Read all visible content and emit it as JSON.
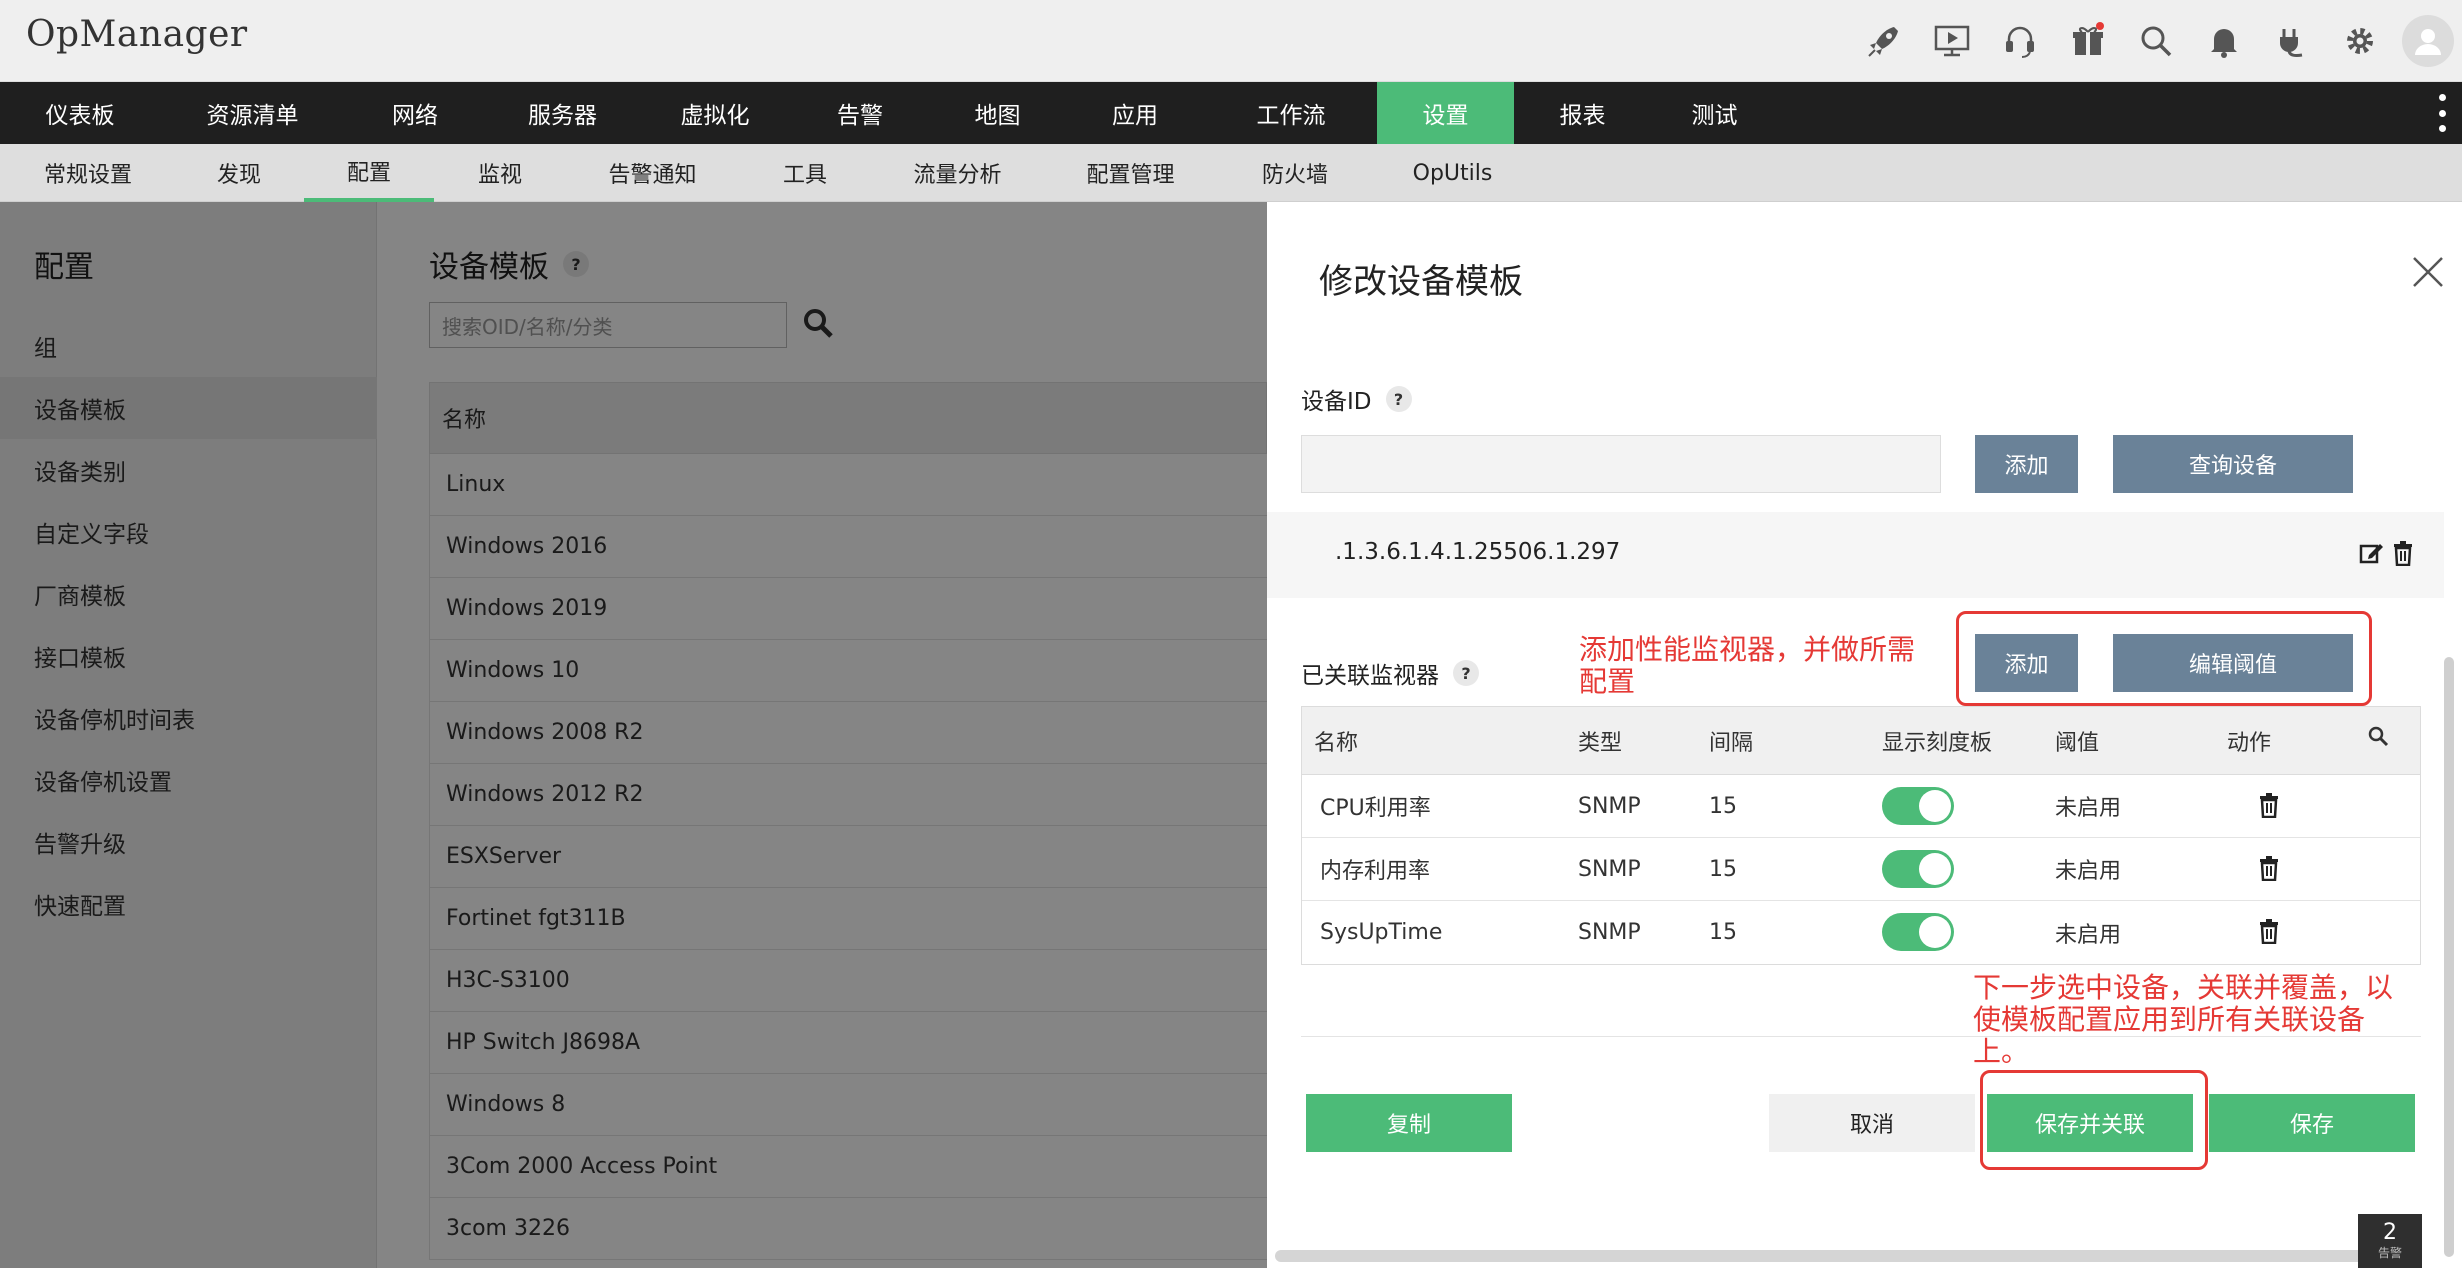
{
  "app": {
    "title": "OpManager"
  },
  "main_nav": [
    {
      "label": "仪表板"
    },
    {
      "label": "资源清单"
    },
    {
      "label": "网络"
    },
    {
      "label": "服务器"
    },
    {
      "label": "虚拟化"
    },
    {
      "label": "告警"
    },
    {
      "label": "地图"
    },
    {
      "label": "应用"
    },
    {
      "label": "工作流"
    },
    {
      "label": "设置",
      "active": true
    },
    {
      "label": "报表"
    },
    {
      "label": "测试"
    }
  ],
  "sub_nav": [
    {
      "label": "常规设置"
    },
    {
      "label": "发现"
    },
    {
      "label": "配置",
      "active": true
    },
    {
      "label": "监视"
    },
    {
      "label": "告警通知"
    },
    {
      "label": "工具"
    },
    {
      "label": "流量分析"
    },
    {
      "label": "配置管理"
    },
    {
      "label": "防火墙"
    },
    {
      "label": "OpUtils"
    }
  ],
  "sidebar": {
    "title": "配置",
    "items": [
      {
        "label": "组"
      },
      {
        "label": "设备模板",
        "active": true
      },
      {
        "label": "设备类别"
      },
      {
        "label": "自定义字段"
      },
      {
        "label": "厂商模板"
      },
      {
        "label": "接口模板"
      },
      {
        "label": "设备停机时间表"
      },
      {
        "label": "设备停机设置"
      },
      {
        "label": "告警升级"
      },
      {
        "label": "快速配置"
      }
    ]
  },
  "list": {
    "title": "设备模板",
    "help": "?",
    "search_placeholder": "搜索OID/名称/分类",
    "column_name": "名称",
    "rows": [
      "Linux",
      "Windows 2016",
      "Windows 2019",
      "Windows 10",
      "Windows 2008 R2",
      "Windows 2012 R2",
      "ESXServer",
      "Fortinet fgt311B",
      "H3C-S3100",
      "HP Switch J8698A",
      "Windows 8",
      "3Com 2000 Access Point",
      "3com 3226"
    ]
  },
  "modal": {
    "title": "修改设备模板",
    "device_id_label": "设备ID",
    "help": "?",
    "add_label": "添加",
    "query_device_label": "查询设备",
    "oid_value": ".1.3.6.1.4.1.25506.1.297",
    "monitors_label": "已关联监视器",
    "edit_threshold_label": "编辑阈值",
    "annotation_1": "添加性能监视器，并做所需配置",
    "annotation_2": "下一步选中设备，关联并覆盖，以使模板配置应用到所有关联设备上。",
    "columns": [
      "名称",
      "类型",
      "间隔",
      "显示刻度板",
      "阈值",
      "动作"
    ],
    "monitors": [
      {
        "name": "CPU利用率",
        "type": "SNMP",
        "interval": "15",
        "dial_enabled": true,
        "threshold": "未启用"
      },
      {
        "name": "内存利用率",
        "type": "SNMP",
        "interval": "15",
        "dial_enabled": true,
        "threshold": "未启用"
      },
      {
        "name": "SysUpTime",
        "type": "SNMP",
        "interval": "15",
        "dial_enabled": true,
        "threshold": "未启用"
      }
    ],
    "copy_label": "复制",
    "cancel_label": "取消",
    "save_associate_label": "保存并关联",
    "save_label": "保存"
  },
  "alarm_badge": {
    "count": "2",
    "label": "告警"
  },
  "colors": {
    "accent": "#4cbb78",
    "nav_bg": "#1f1f1f",
    "button_blue": "#6a8298",
    "annotation_red": "#e53935"
  }
}
